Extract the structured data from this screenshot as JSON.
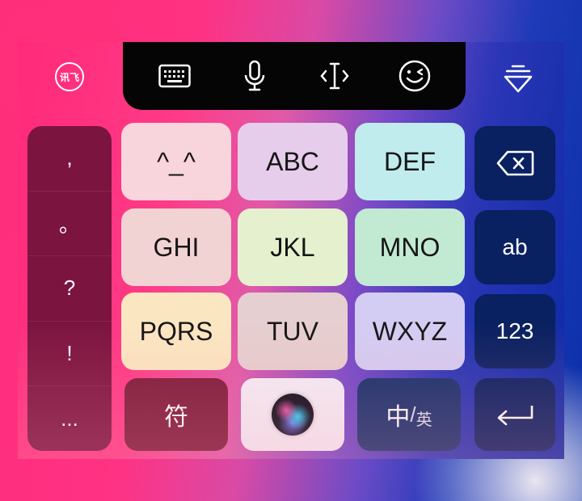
{
  "toolbar": {
    "logo_text": "讯飞",
    "buttons": [
      {
        "icon": "keyboard-icon"
      },
      {
        "icon": "microphone-icon"
      },
      {
        "icon": "text-cursor-icon"
      },
      {
        "icon": "emoji-wink-icon"
      }
    ],
    "collapse_icon": "collapse-keyboard-icon"
  },
  "punctuation": [
    ",",
    "。",
    "?",
    "!",
    "..."
  ],
  "keys": [
    {
      "label": "^_^",
      "color": "#f8d4dc"
    },
    {
      "label": "ABC",
      "color": "#e6cdec"
    },
    {
      "label": "DEF",
      "color": "#c0ecee"
    },
    {
      "label": "GHI",
      "color": "#f2d3d3"
    },
    {
      "label": "JKL",
      "color": "#e5f0cf"
    },
    {
      "label": "MNO",
      "color": "#c2ead3"
    },
    {
      "label": "PQRS",
      "color": "#fbe6c2"
    },
    {
      "label": "TUV",
      "color": "#e6cfd0"
    },
    {
      "label": "WXYZ",
      "color": "#d4cdf3"
    }
  ],
  "side_keys": {
    "backspace_icon": "backspace-icon",
    "ab": "ab",
    "num": "123",
    "enter_icon": "enter-icon"
  },
  "bottom": {
    "symbol": "符",
    "lang_main": "中",
    "lang_sep": "/",
    "lang_alt": "英"
  },
  "colors": {
    "punct_bg": "#7c1440",
    "symbol_bg": "#7c1a39",
    "side_key_bg": "#092061",
    "siri_key_bg": "#f3eef6",
    "lang_bg": "#15306c"
  }
}
